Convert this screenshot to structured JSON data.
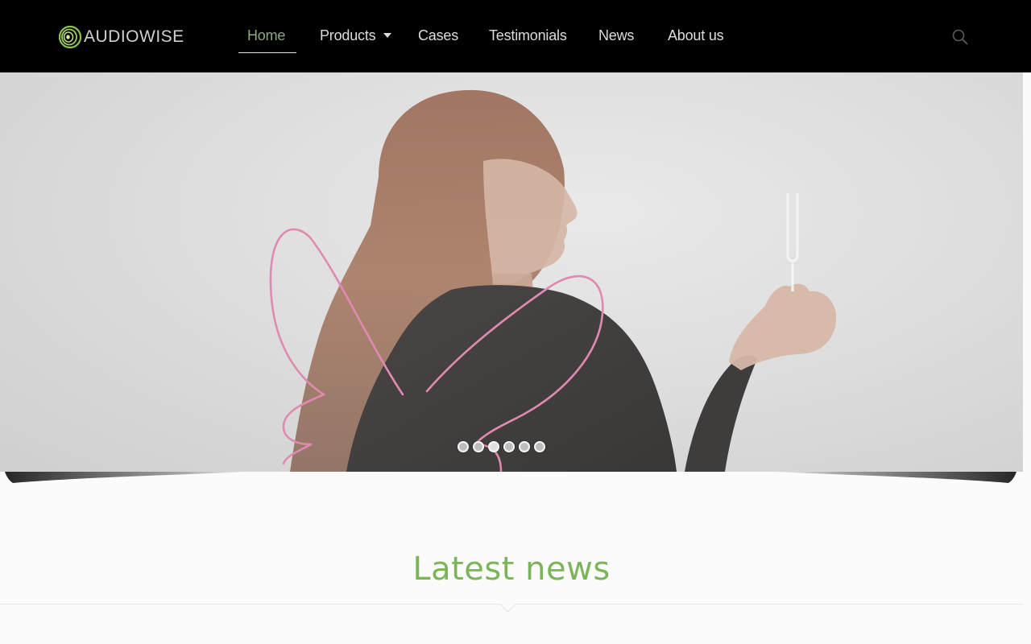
{
  "brand": {
    "name": "AUDIOWISE",
    "accent_color": "#8bc34a",
    "logo_icon": "concentric-rings-icon"
  },
  "nav": {
    "items": [
      {
        "label": "Home",
        "active": true
      },
      {
        "label": "Products",
        "has_dropdown": true
      },
      {
        "label": "Cases"
      },
      {
        "label": "Testimonials"
      },
      {
        "label": "News"
      },
      {
        "label": "About us"
      }
    ],
    "search_icon": "search-icon"
  },
  "hero": {
    "slide_count": 6,
    "active_slide": 1
  },
  "latest_news": {
    "title": "Latest news",
    "title_color": "#7cb45a"
  }
}
